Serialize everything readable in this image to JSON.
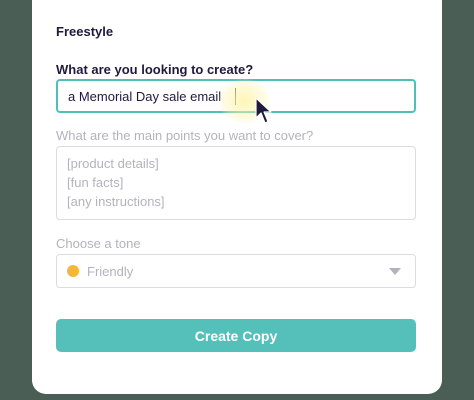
{
  "form": {
    "heading": "Freestyle",
    "create_label": "What are you looking to create?",
    "create_value": "a Memorial Day sale email",
    "points_label": "What are the main points you want to cover?",
    "points_placeholder": [
      "[product details]",
      "[fun facts]",
      "[any instructions]"
    ],
    "tone_label": "Choose a tone",
    "tone_value": "Friendly",
    "tone_icon": "smile-emoji-icon",
    "submit_label": "Create Copy"
  },
  "colors": {
    "accent": "#55c0ba",
    "focus_border": "#4fbfba",
    "heading_text": "#1f1a3d",
    "muted_text": "#b4b3bc",
    "background": "#4a5e55"
  }
}
